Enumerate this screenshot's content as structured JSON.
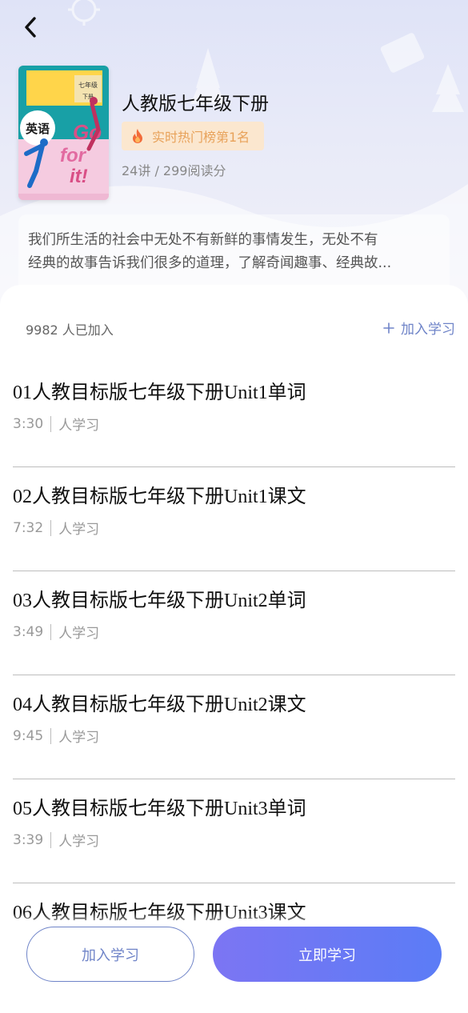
{
  "header": {
    "back_icon": "chevron-left-icon"
  },
  "book": {
    "title": "人教版七年级下册",
    "rank": "实时热门榜第1名",
    "rank_icon": "flame-icon",
    "meta": "24讲 / 299阅读分",
    "description_lines": [
      "我们所生活的社会中无处不有新鲜的事情发生，无处不有",
      "经典的故事告诉我们很多的道理，了解奇闻趣事、经典故..."
    ],
    "cover": {
      "subject": "英语",
      "grade": "七年级",
      "volume": "下册",
      "art_text": [
        "Go",
        "for",
        "it!"
      ]
    }
  },
  "course": {
    "joined_text": "9982 人已加入",
    "join_link_label": "加入学习",
    "lessons": [
      {
        "title": "01人教目标版七年级下册Unit1单词",
        "duration": "3:30",
        "tag": "人学习"
      },
      {
        "title": "02人教目标版七年级下册Unit1课文",
        "duration": "7:32",
        "tag": "人学习"
      },
      {
        "title": "03人教目标版七年级下册Unit2单词",
        "duration": "3:49",
        "tag": "人学习"
      },
      {
        "title": "04人教目标版七年级下册Unit2课文",
        "duration": "9:45",
        "tag": "人学习"
      },
      {
        "title": "05人教目标版七年级下册Unit3单词",
        "duration": "3:39",
        "tag": "人学习"
      },
      {
        "title": "06人教目标版七年级下册Unit3课文",
        "duration": "",
        "tag": ""
      }
    ]
  },
  "actions": {
    "join_label": "加入学习",
    "start_label": "立即学习"
  },
  "colors": {
    "accent": "#6f84c8",
    "rank_bg": "#fbe7cf",
    "rank_text": "#e8a25a",
    "start_gradient_from": "#7c75f3",
    "start_gradient_to": "#5b7cf6"
  }
}
